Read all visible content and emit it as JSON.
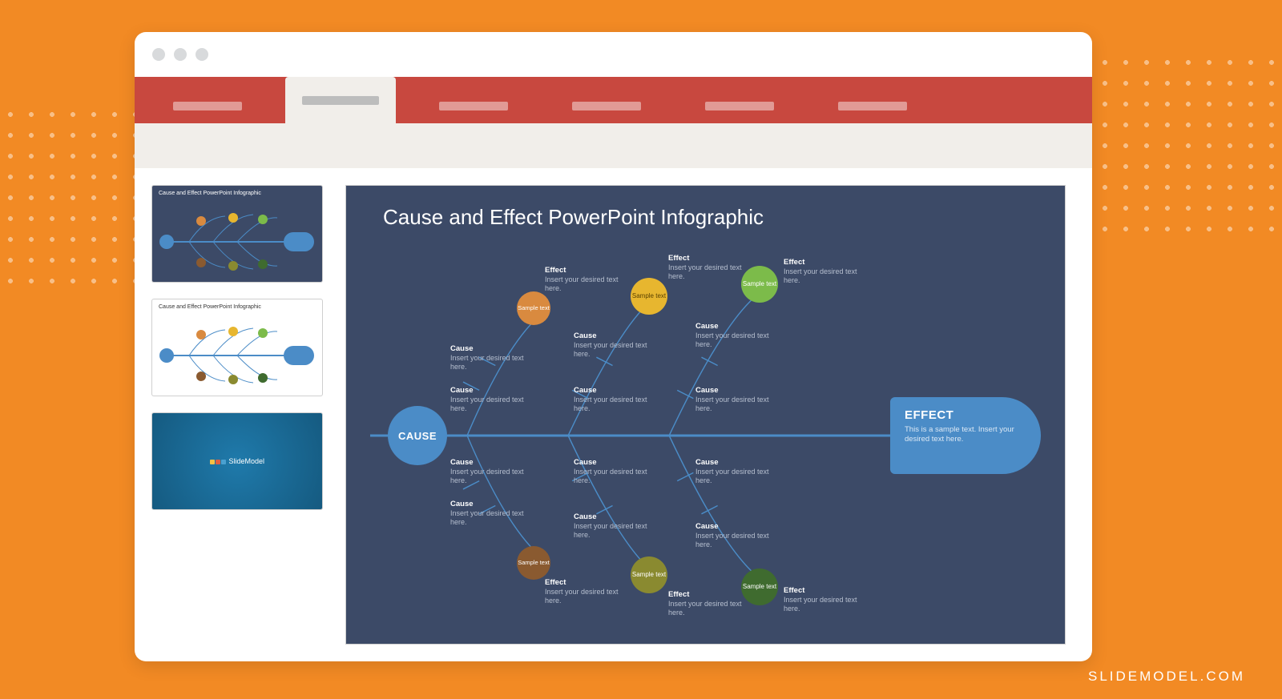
{
  "footer": {
    "brand": "SLIDEMODEL.COM"
  },
  "ribbon_tabs": 6,
  "thumbnails": {
    "title": "Cause and Effect PowerPoint Infographic",
    "brand": "SlideModel"
  },
  "slide": {
    "title": "Cause and Effect PowerPoint Infographic",
    "cause_label": "CAUSE",
    "effect": {
      "heading": "EFFECT",
      "sub": "This is a sample text. Insert your desired text here."
    },
    "sample_text": "Sample text",
    "labels": {
      "cause": "Cause",
      "effect": "Effect",
      "desc": "Insert your desired text here."
    },
    "colors": {
      "orange": "#d98a3f",
      "yellow": "#e7b62f",
      "green": "#7cbb4a",
      "brown": "#8a5a30",
      "olive": "#8a8a30",
      "darkgreen": "#3f6b2f"
    }
  }
}
